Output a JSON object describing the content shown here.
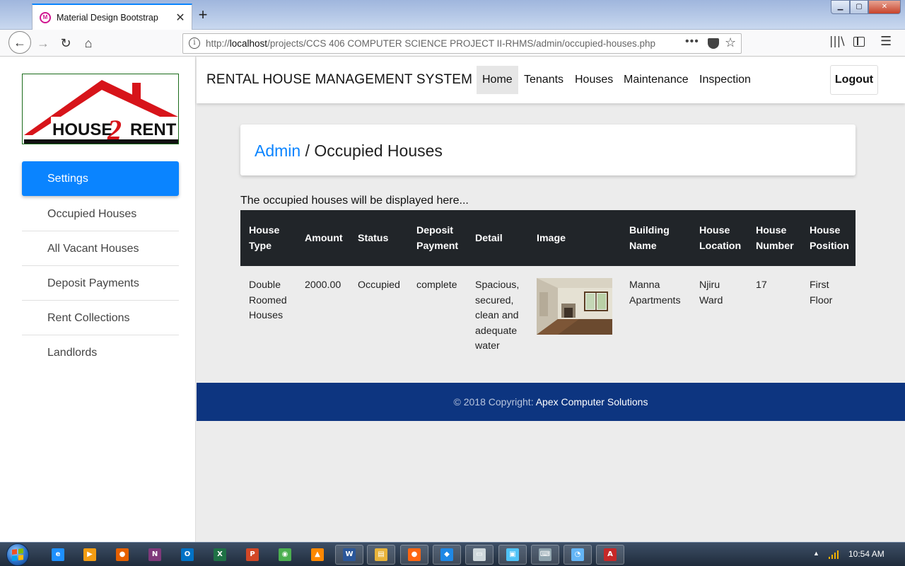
{
  "browser": {
    "tab_title": "Material Design Bootstrap",
    "tab_close": "✕",
    "new_tab": "+",
    "url_prefix": "http://",
    "url_host": "localhost",
    "url_path": "/projects/CCS 406 COMPUTER SCIENCE PROJECT II-RHMS/admin/occupied-houses.php",
    "url_more": "•••"
  },
  "logo": {
    "word1": "HOUSE",
    "word2": "2",
    "word3": "RENT"
  },
  "sidebar": {
    "items": [
      {
        "label": "Settings",
        "active": true
      },
      {
        "label": "Occupied Houses",
        "active": false
      },
      {
        "label": "All Vacant Houses",
        "active": false
      },
      {
        "label": "Deposit Payments",
        "active": false
      },
      {
        "label": "Rent Collections",
        "active": false
      },
      {
        "label": "Landlords",
        "active": false
      }
    ]
  },
  "topnav": {
    "brand": "RENTAL HOUSE MANAGEMENT SYSTEM",
    "links": [
      "Home",
      "Tenants",
      "Houses",
      "Maintenance",
      "Inspection"
    ],
    "active_link": "Home",
    "logout": "Logout"
  },
  "breadcrumb": {
    "link": "Admin",
    "separator": " / ",
    "current": "Occupied Houses"
  },
  "intro": "The occupied houses will be displayed here...",
  "table": {
    "headers": [
      [
        "House",
        "Type"
      ],
      [
        "Amount"
      ],
      [
        "Status"
      ],
      [
        "Deposit",
        "Payment"
      ],
      [
        "Detail"
      ],
      [
        "Image"
      ],
      [
        "Building",
        "Name"
      ],
      [
        "House",
        "Location"
      ],
      [
        "House",
        "Number"
      ],
      [
        "House",
        "Position"
      ]
    ],
    "rows": [
      {
        "house_type": [
          "Double",
          "Roomed",
          "Houses"
        ],
        "amount": "2000.00",
        "status": "Occupied",
        "deposit_payment": "complete",
        "detail": [
          "Spacious,",
          "secured,",
          "clean and",
          "adequate",
          "water"
        ],
        "image": "room-photo",
        "building_name": [
          "Manna",
          "Apartments"
        ],
        "house_location": [
          "Njiru",
          "Ward"
        ],
        "house_number": "17",
        "house_position": [
          "First",
          "Floor"
        ]
      }
    ]
  },
  "footer": {
    "prefix": "© 2018 Copyright: ",
    "link": "Apex Computer Solutions"
  },
  "taskbar": {
    "clock": "10:54 AM",
    "apps": [
      {
        "icon": "internet-explorer-icon",
        "color": "#1e90ff",
        "glyph": "e"
      },
      {
        "icon": "media-player-icon",
        "color": "#f39c12",
        "glyph": "▶"
      },
      {
        "icon": "firefox-dev-icon",
        "color": "#e66000",
        "glyph": "●"
      },
      {
        "icon": "onenote-icon",
        "color": "#80397b",
        "glyph": "N"
      },
      {
        "icon": "outlook-icon",
        "color": "#0072c6",
        "glyph": "O"
      },
      {
        "icon": "excel-icon",
        "color": "#1e7145",
        "glyph": "X"
      },
      {
        "icon": "powerpoint-icon",
        "color": "#d24726",
        "glyph": "P"
      },
      {
        "icon": "chrome-icon",
        "color": "#4caf50",
        "glyph": "◉"
      },
      {
        "icon": "vlc-icon",
        "color": "#ff8800",
        "glyph": "▲"
      },
      {
        "icon": "word-icon",
        "color": "#2b579a",
        "glyph": "W"
      },
      {
        "icon": "file-explorer-icon",
        "color": "#e8b33a",
        "glyph": "▤"
      },
      {
        "icon": "firefox-icon",
        "color": "#ff6611",
        "glyph": "●"
      },
      {
        "icon": "visual-studio-code-icon",
        "color": "#1e88e5",
        "glyph": "◆"
      },
      {
        "icon": "window-app-icon",
        "color": "#cfd8dc",
        "glyph": "▭"
      },
      {
        "icon": "remote-desktop-icon",
        "color": "#4fc3f7",
        "glyph": "▣"
      },
      {
        "icon": "keyboard-icon",
        "color": "#90a4ae",
        "glyph": "⌨"
      },
      {
        "icon": "control-panel-icon",
        "color": "#64b5f6",
        "glyph": "◔"
      },
      {
        "icon": "acrobat-icon",
        "color": "#c62828",
        "glyph": "A"
      }
    ]
  }
}
